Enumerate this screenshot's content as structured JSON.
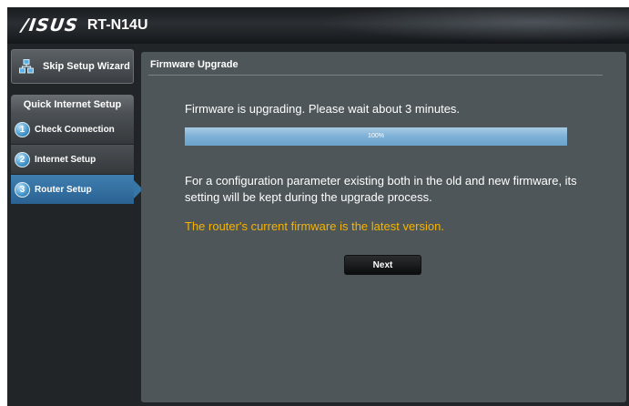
{
  "header": {
    "brand": "/ISUS",
    "model": "RT-N14U"
  },
  "sidebar": {
    "skip_label": "Skip Setup Wizard",
    "qis_title": "Quick Internet Setup",
    "steps": [
      {
        "num": "1",
        "label": "Check Connection",
        "active": false
      },
      {
        "num": "2",
        "label": "Internet Setup",
        "active": false
      },
      {
        "num": "3",
        "label": "Router Setup",
        "active": true
      }
    ]
  },
  "main": {
    "title": "Firmware Upgrade",
    "upgrading_message": "Firmware is upgrading. Please wait about 3 minutes.",
    "progress_text": "100%",
    "progress_value": 1.0,
    "config_note": "For a configuration parameter existing both in the old and new firmware, its setting will be kept during the upgrade process.",
    "status_message": "The router's current firmware is the latest version.",
    "next_label": "Next"
  },
  "colors": {
    "accent": "#2f6fa0",
    "status_text": "#f5b400",
    "panel_bg": "#4e5659"
  },
  "icons": {
    "skip": "network-icon",
    "step": "numbered-circle-icon"
  }
}
